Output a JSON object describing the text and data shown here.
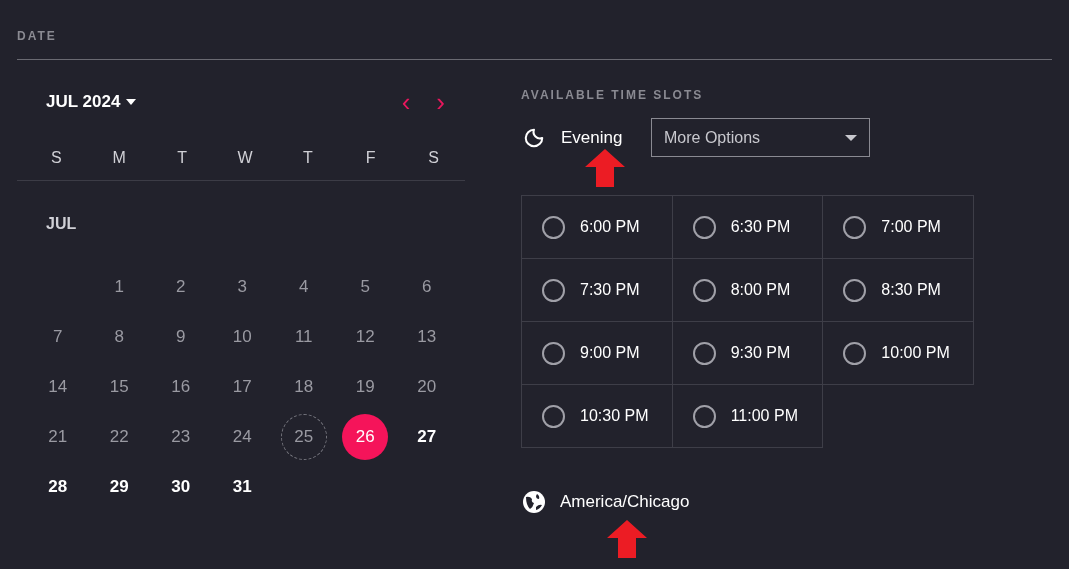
{
  "section_title": "DATE",
  "calendar": {
    "month_label": "JUL 2024",
    "prev": "‹",
    "next": "›",
    "weekdays": [
      "S",
      "M",
      "T",
      "W",
      "T",
      "F",
      "S"
    ],
    "month_heading": "JUL",
    "weeks": [
      {
        "kind": "leading",
        "days": [
          {
            "label": "1",
            "disabled": true,
            "today": false,
            "selected": false
          },
          {
            "label": "2",
            "disabled": true,
            "today": false,
            "selected": false
          },
          {
            "label": "3",
            "disabled": true,
            "today": false,
            "selected": false
          },
          {
            "label": "4",
            "disabled": true,
            "today": false,
            "selected": false
          },
          {
            "label": "5",
            "disabled": true,
            "today": false,
            "selected": false
          },
          {
            "label": "6",
            "disabled": true,
            "today": false,
            "selected": false
          }
        ]
      },
      {
        "days": [
          {
            "label": "7",
            "disabled": true,
            "today": false,
            "selected": false
          },
          {
            "label": "8",
            "disabled": true,
            "today": false,
            "selected": false
          },
          {
            "label": "9",
            "disabled": true,
            "today": false,
            "selected": false
          },
          {
            "label": "10",
            "disabled": true,
            "today": false,
            "selected": false
          },
          {
            "label": "11",
            "disabled": true,
            "today": false,
            "selected": false
          },
          {
            "label": "12",
            "disabled": true,
            "today": false,
            "selected": false
          },
          {
            "label": "13",
            "disabled": true,
            "today": false,
            "selected": false
          }
        ]
      },
      {
        "days": [
          {
            "label": "14",
            "disabled": true,
            "today": false,
            "selected": false
          },
          {
            "label": "15",
            "disabled": true,
            "today": false,
            "selected": false
          },
          {
            "label": "16",
            "disabled": true,
            "today": false,
            "selected": false
          },
          {
            "label": "17",
            "disabled": true,
            "today": false,
            "selected": false
          },
          {
            "label": "18",
            "disabled": true,
            "today": false,
            "selected": false
          },
          {
            "label": "19",
            "disabled": true,
            "today": false,
            "selected": false
          },
          {
            "label": "20",
            "disabled": true,
            "today": false,
            "selected": false
          }
        ]
      },
      {
        "days": [
          {
            "label": "21",
            "disabled": true,
            "today": false,
            "selected": false
          },
          {
            "label": "22",
            "disabled": true,
            "today": false,
            "selected": false
          },
          {
            "label": "23",
            "disabled": true,
            "today": false,
            "selected": false
          },
          {
            "label": "24",
            "disabled": true,
            "today": false,
            "selected": false
          },
          {
            "label": "25",
            "disabled": true,
            "today": true,
            "selected": false
          },
          {
            "label": "26",
            "disabled": false,
            "today": false,
            "selected": true
          },
          {
            "label": "27",
            "disabled": false,
            "today": false,
            "selected": false
          }
        ]
      },
      {
        "days": [
          {
            "label": "28",
            "disabled": false,
            "today": false,
            "selected": false
          },
          {
            "label": "29",
            "disabled": false,
            "today": false,
            "selected": false
          },
          {
            "label": "30",
            "disabled": false,
            "today": false,
            "selected": false
          },
          {
            "label": "31",
            "disabled": false,
            "today": false,
            "selected": false
          }
        ]
      }
    ]
  },
  "time_slots": {
    "title": "AVAILABLE TIME SLOTS",
    "period": "Evening",
    "dropdown": {
      "value": "More Options"
    },
    "slots": [
      {
        "label": "6:00 PM",
        "selected": false
      },
      {
        "label": "6:30 PM",
        "selected": false
      },
      {
        "label": "7:00 PM",
        "selected": false
      },
      {
        "label": "7:30 PM",
        "selected": false
      },
      {
        "label": "8:00 PM",
        "selected": false
      },
      {
        "label": "8:30 PM",
        "selected": false
      },
      {
        "label": "9:00 PM",
        "selected": false
      },
      {
        "label": "9:30 PM",
        "selected": false
      },
      {
        "label": "10:00 PM",
        "selected": false
      },
      {
        "label": "10:30 PM",
        "selected": false
      },
      {
        "label": "11:00 PM",
        "selected": false
      }
    ],
    "timezone": "America/Chicago"
  }
}
